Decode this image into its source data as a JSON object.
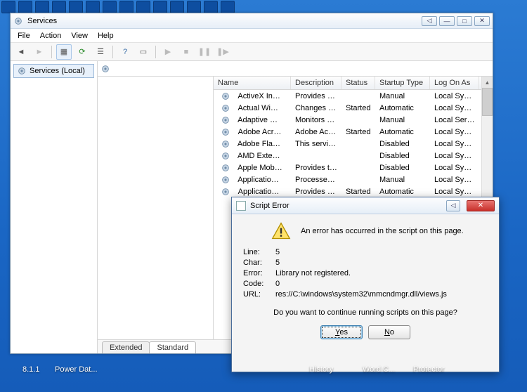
{
  "window": {
    "title": "Services",
    "winbuttons": {
      "prev": "◁",
      "min": "—",
      "max": "□",
      "close": "✕"
    },
    "menu": [
      "File",
      "Action",
      "View",
      "Help"
    ],
    "tree_label": "Services (Local)",
    "tabs": {
      "extended": "Extended",
      "standard": "Standard"
    },
    "columns": [
      "Name",
      "Description",
      "Status",
      "Startup Type",
      "Log On As"
    ],
    "rows": [
      {
        "name": "ActiveX Installer (...",
        "desc": "Provides Us...",
        "status": "",
        "startup": "Manual",
        "logon": "Local Syste..."
      },
      {
        "name": "Actual Window M...",
        "desc": "Changes th...",
        "status": "Started",
        "startup": "Automatic",
        "logon": "Local Syste..."
      },
      {
        "name": "Adaptive Brightness",
        "desc": "Monitors a...",
        "status": "",
        "startup": "Manual",
        "logon": "Local Service"
      },
      {
        "name": "Adobe Acrobat U...",
        "desc": "Adobe Acro...",
        "status": "Started",
        "startup": "Automatic",
        "logon": "Local Syste..."
      },
      {
        "name": "Adobe Flash Playe...",
        "desc": "This service ...",
        "status": "",
        "startup": "Disabled",
        "logon": "Local Syste..."
      },
      {
        "name": "AMD External Eve...",
        "desc": "",
        "status": "",
        "startup": "Disabled",
        "logon": "Local Syste..."
      },
      {
        "name": "Apple Mobile Devi...",
        "desc": "Provides th...",
        "status": "",
        "startup": "Disabled",
        "logon": "Local Syste..."
      },
      {
        "name": "Application Experi...",
        "desc": "Processes a...",
        "status": "",
        "startup": "Manual",
        "logon": "Local Syste..."
      },
      {
        "name": "Application Host ...",
        "desc": "Provides ad...",
        "status": "Started",
        "startup": "Automatic",
        "logon": "Local Syste..."
      }
    ]
  },
  "dialog": {
    "title": "Script Error",
    "message": "An error has occurred in the script on this page.",
    "labels": {
      "line": "Line:",
      "char": "Char:",
      "error": "Error:",
      "code": "Code:",
      "url": "URL:"
    },
    "values": {
      "line": "5",
      "char": "5",
      "error": "Library not registered.",
      "code": "0",
      "url": "res://C:\\windows\\system32\\mmcndmgr.dll/views.js"
    },
    "question": "Do you want to continue running scripts on this page?",
    "yes": "Yes",
    "no": "No"
  },
  "desktop": {
    "l1": "8.1.1",
    "l2": "Power Dat...",
    "l3": "History",
    "l4": "Word C...",
    "l5": "Protector"
  }
}
